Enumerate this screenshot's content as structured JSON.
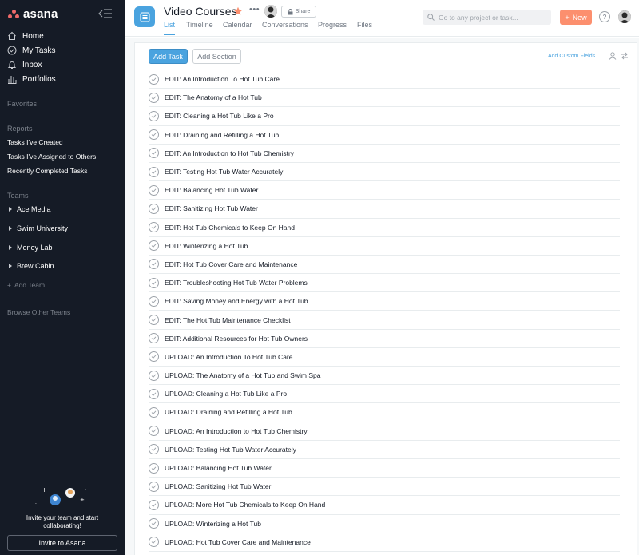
{
  "sidebar": {
    "logo_text": "asana",
    "nav": [
      {
        "label": "Home",
        "icon": "home-icon"
      },
      {
        "label": "My Tasks",
        "icon": "check-circle-icon"
      },
      {
        "label": "Inbox",
        "icon": "bell-icon"
      },
      {
        "label": "Portfolios",
        "icon": "bar-chart-icon"
      }
    ],
    "favorites_label": "Favorites",
    "reports_label": "Reports",
    "reports": [
      "Tasks I've Created",
      "Tasks I've Assigned to Others",
      "Recently Completed Tasks"
    ],
    "teams_label": "Teams",
    "teams": [
      "Ace Media",
      "Swim University",
      "Money Lab",
      "Brew Cabin"
    ],
    "add_team": "Add Team",
    "browse_teams": "Browse Other Teams",
    "invite_line1": "Invite your team and start",
    "invite_line2": "collaborating!",
    "invite_button": "Invite to Asana"
  },
  "header": {
    "project_title": "Video Courses",
    "share_label": "Share",
    "tabs": [
      "List",
      "Timeline",
      "Calendar",
      "Conversations",
      "Progress",
      "Files"
    ],
    "active_tab": "List",
    "search_placeholder": "Go to any project or task...",
    "new_label": "New",
    "help_label": "?"
  },
  "toolbar": {
    "add_task": "Add Task",
    "add_section": "Add Section",
    "custom_fields": "Add Custom Fields"
  },
  "tasks": [
    "EDIT: An Introduction To Hot Tub Care",
    "EDIT: The Anatomy of a Hot Tub",
    "EDIT: Cleaning a Hot Tub Like a Pro",
    "EDIT: Draining and Refilling a Hot Tub",
    "EDIT: An Introduction to Hot Tub Chemistry",
    "EDIT: Testing Hot Tub Water Accurately",
    "EDIT: Balancing Hot Tub Water",
    "EDIT: Sanitizing Hot Tub Water",
    "EDIT: Hot Tub Chemicals to Keep On Hand",
    "EDIT: Winterizing a Hot Tub",
    "EDIT: Hot Tub Cover Care and Maintenance",
    "EDIT: Troubleshooting Hot Tub Water Problems",
    "EDIT: Saving Money and Energy with a Hot Tub",
    "EDIT: The Hot Tub Maintenance Checklist",
    "EDIT: Additional Resources for Hot Tub Owners",
    "UPLOAD: An Introduction To Hot Tub Care",
    "UPLOAD: The Anatomy of a Hot Tub and Swim Spa",
    "UPLOAD: Cleaning a Hot Tub Like a Pro",
    "UPLOAD: Draining and Refilling a Hot Tub",
    "UPLOAD: An Introduction to Hot Tub Chemistry",
    "UPLOAD: Testing Hot Tub Water Accurately",
    "UPLOAD: Balancing Hot Tub Water",
    "UPLOAD: Sanitizing Hot Tub Water",
    "UPLOAD: More Hot Tub Chemicals to Keep On Hand",
    "UPLOAD: Winterizing a Hot Tub",
    "UPLOAD: Hot Tub Cover Care and Maintenance"
  ],
  "colors": {
    "sidebar_bg": "#151b26",
    "accent_blue": "#4aa3df",
    "new_button": "#fc8f6e",
    "star": "#fc8f6e",
    "logo_coral": "#f06a6a"
  }
}
